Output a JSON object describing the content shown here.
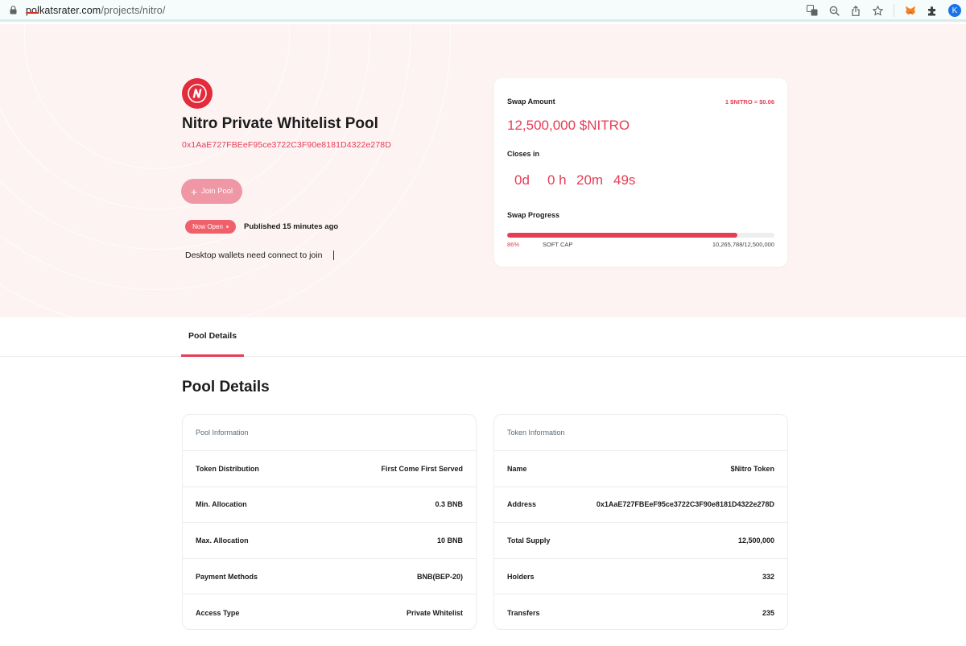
{
  "browser": {
    "url_domain": "polkatsrater.com",
    "url_path": "/projects/nitro/",
    "avatar_letter": "K"
  },
  "hero": {
    "title": "Nitro Private Whitelist Pool",
    "address": "0x1AaE727FBEeF95ce3722C3F90e8181D4322e278D",
    "join_label": "Join Pool",
    "status_label": "Now Open",
    "published": "Published 15 minutes ago",
    "connect_text": "Desktop wallets need connect to join"
  },
  "swap": {
    "amount_label": "Swap Amount",
    "rate": "1 $NITRO = $0.06",
    "amount": "12,500,000 $NITRO",
    "closes_label": "Closes in",
    "countdown": {
      "days": "0d",
      "hours": "0 h",
      "minutes": "20m",
      "seconds": "49s"
    },
    "progress_label": "Swap Progress",
    "progress_pct": "86%",
    "progress_value": 0.86,
    "soft_cap": "SOFT CAP",
    "progress_count": "10,265,788/12,500,000"
  },
  "tabs": [
    {
      "label": "Pool Details"
    }
  ],
  "section_heading": "Pool Details",
  "pool_info": {
    "heading": "Pool Information",
    "rows": [
      {
        "key": "Token Distribution",
        "value": "First Come First Served"
      },
      {
        "key": "Min. Allocation",
        "value": "0.3 BNB"
      },
      {
        "key": "Max. Allocation",
        "value": "10 BNB"
      },
      {
        "key": "Payment Methods",
        "value": "BNB(BEP-20)"
      },
      {
        "key": "Access Type",
        "value": "Private Whitelist"
      }
    ]
  },
  "token_info": {
    "heading": "Token Information",
    "rows": [
      {
        "key": "Name",
        "value": "$Nitro Token"
      },
      {
        "key": "Address",
        "value": "0x1AaE727FBEeF95ce3722C3F90e8181D4322e278D"
      },
      {
        "key": "Total Supply",
        "value": "12,500,000"
      },
      {
        "key": "Holders",
        "value": "332"
      },
      {
        "key": "Transfers",
        "value": "235"
      }
    ]
  },
  "colors": {
    "accent": "#e53d55",
    "hero_bg": "#fdf3f3",
    "badge": "#f0606b",
    "logo": "#e32b3c"
  }
}
